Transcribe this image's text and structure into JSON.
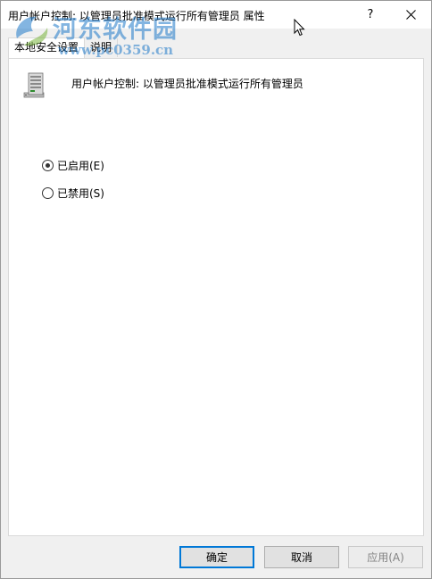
{
  "window": {
    "title": "用户帐户控制: 以管理员批准模式运行所有管理员 属性",
    "help_label": "?"
  },
  "tabs": [
    {
      "label": "本地安全设置",
      "active": true
    },
    {
      "label": "说明",
      "active": false
    }
  ],
  "policy": {
    "name": "用户帐户控制: 以管理员批准模式运行所有管理员",
    "icon": "server-policy-icon"
  },
  "options": [
    {
      "label": "已启用(E)",
      "checked": true
    },
    {
      "label": "已禁用(S)",
      "checked": false
    }
  ],
  "buttons": {
    "ok": "确定",
    "cancel": "取消",
    "apply": "应用(A)"
  },
  "watermark": {
    "text": "河东软件园",
    "url": "www.pc0359.cn"
  },
  "colors": {
    "accent": "#0078d7",
    "watermark": "#1e78c8"
  }
}
